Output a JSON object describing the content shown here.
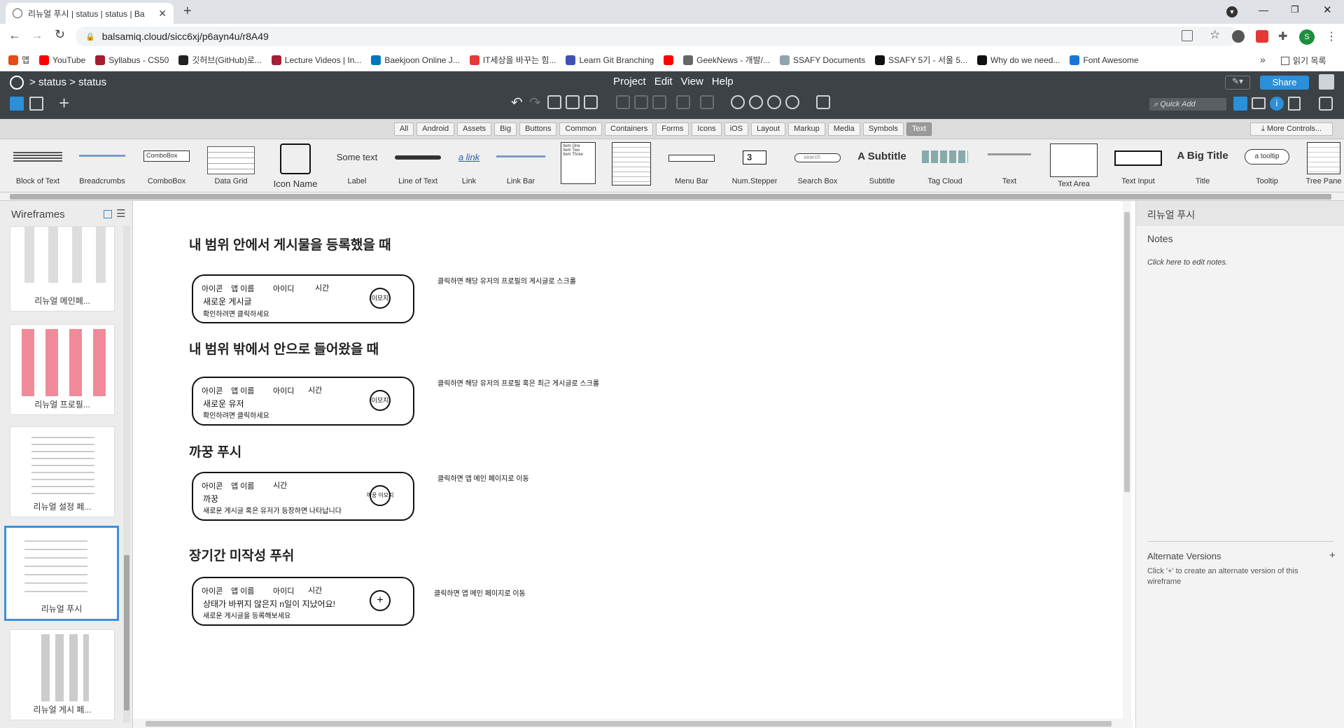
{
  "browser": {
    "tab_title": "리뉴얼 푸시 | status | status | Ba",
    "url": "balsamiq.cloud/sicc6xj/p6ayn4u/r8A49",
    "avatar_letter": "S",
    "bookmarks": [
      {
        "label": "앱",
        "color": "#e64a19"
      },
      {
        "label": "YouTube",
        "color": "#ff0000"
      },
      {
        "label": "Syllabus - CS50",
        "color": "#a51c30"
      },
      {
        "label": "깃허브(GitHub)로...",
        "color": "#222"
      },
      {
        "label": "Lecture Videos | In...",
        "color": "#a31f34"
      },
      {
        "label": "Baekjoon Online J...",
        "color": "#0076c0"
      },
      {
        "label": "IT세상을 바꾸는 힘...",
        "color": "#e53935"
      },
      {
        "label": "Learn Git Branching",
        "color": "#3f51b5"
      },
      {
        "label": "",
        "color": "#ff0000"
      },
      {
        "label": "GeekNews - 개발/...",
        "color": "#666"
      },
      {
        "label": "SSAFY Documents",
        "color": "#90a4ae"
      },
      {
        "label": "SSAFY 5기 - 서울 5...",
        "color": "#111"
      },
      {
        "label": "Why do we need...",
        "color": "#111"
      },
      {
        "label": "Font Awesome",
        "color": "#1976d2"
      }
    ],
    "reading_list": "읽기 목록"
  },
  "app": {
    "breadcrumb": [
      "status",
      "status"
    ],
    "menu": [
      "Project",
      "Edit",
      "View",
      "Help"
    ],
    "share_label": "Share",
    "quick_add_placeholder": "Quick Add",
    "more_controls": "More Controls...",
    "filters": [
      "All",
      "Android",
      "Assets",
      "Big",
      "Buttons",
      "Common",
      "Containers",
      "Forms",
      "Icons",
      "iOS",
      "Layout",
      "Markup",
      "Media",
      "Symbols",
      "Text"
    ],
    "selected_filter": "Text",
    "library": {
      "block_of_text": "Block of Text",
      "breadcrumbs": "Breadcrumbs",
      "combobox": "ComboBox",
      "data_grid": "Data Grid",
      "icon_name": "Icon Name",
      "label": "Label",
      "line_of_text": "Line of Text",
      "link": "Link",
      "link_bar": "Link Bar",
      "menu_bar": "Menu Bar",
      "num_stepper": "Num.Stepper",
      "search_box": "Search Box",
      "subtitle": "Subtitle",
      "tag_cloud": "Tag Cloud",
      "text": "Text",
      "text_area": "Text Area",
      "text_input": "Text Input",
      "title": "Title",
      "tooltip": "Tooltip",
      "tree_pane": "Tree Pane",
      "combobox_preview": "ComboBox",
      "label_preview": "Some text",
      "link_preview": "a link",
      "stepper_value": "3",
      "search_preview": "search",
      "subtitle_preview": "A Subtitle",
      "title_preview": "A Big Title",
      "tooltip_preview": "a tooltip",
      "list_items": [
        "Item One",
        "Item Two",
        "Item Three"
      ]
    }
  },
  "left_panel": {
    "title": "Wireframes",
    "items": [
      "리뉴얼 메인페...",
      "리뉴얼 프로필...",
      "리뉴얼 설정 페...",
      "리뉴얼 푸시",
      "리뉴얼 게시 페..."
    ],
    "selected_index": 3
  },
  "canvas": {
    "sections": [
      {
        "heading": "내 범위 안에서 게시물을 등록했을 때",
        "top_row": [
          "아이콘",
          "앱 이름",
          "아이디",
          "시간"
        ],
        "line1": "새로운 게시글",
        "line2": "확인하려면 클릭하세요",
        "circle": "이모지",
        "note": "클릭하면 해당 유저의 프로필의 게시글로 스크롤"
      },
      {
        "heading": "내 범위 밖에서 안으로 들어왔을 때",
        "top_row": [
          "아이콘",
          "앱 이름",
          "아이디",
          "시간"
        ],
        "line1": "새로운 유저",
        "line2": "확인하려면 클릭하세요",
        "circle": "이모지",
        "note": "클릭하면 해당 유저의 프로필 혹은 최근 게시글로 스크롤"
      },
      {
        "heading": "까꿍 푸시",
        "top_row": [
          "아이콘",
          "앱 이름",
          "시간"
        ],
        "line1": "까꿍",
        "line2": "새로운 게시글 혹은 유저가 등장하면 나타납니다",
        "circle": "까꿍 이모지",
        "note": "클릭하면 앱 메인 페이지로 이동"
      },
      {
        "heading": "장기간 미작성 푸쉬",
        "top_row": [
          "아이콘",
          "앱 이름",
          "아이디",
          "시간"
        ],
        "line1": "상태가 바뀌지 않은지 n일이 지났어요!",
        "line2": "새로운 게시글을 등록해보세요",
        "circle": "+",
        "note": "클릭하면 앱 메인 페이지로 이동"
      }
    ]
  },
  "right_panel": {
    "title": "리뉴얼 푸시",
    "notes_label": "Notes",
    "notes_hint": "Click here to edit notes.",
    "alt_title": "Alternate Versions",
    "alt_hint": "Click '+' to create an alternate version of this wireframe",
    "add_glyph": "+"
  },
  "colors": {
    "app_header": "#3d4246",
    "accent": "#2b8fd9",
    "selection": "#3d8fdc"
  }
}
